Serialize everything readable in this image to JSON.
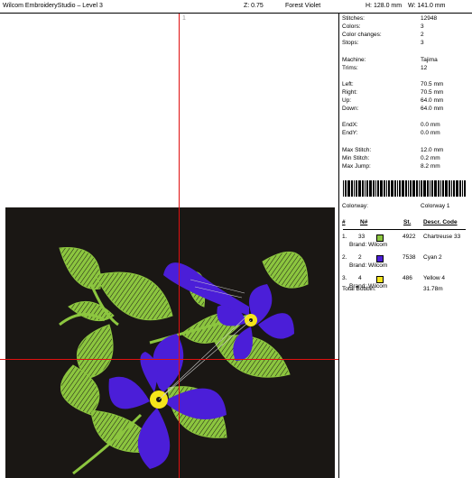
{
  "title_bar": {
    "app_title": "Wilcom EmbroideryStudio – Level 3",
    "zoom": "Z: 0.75",
    "fabric": "Forest Violet",
    "height": "H: 128.0 mm",
    "width": "W: 141.0 mm"
  },
  "canvas": {
    "origin_marker": "1"
  },
  "stats": [
    {
      "label": "Stitches:",
      "value": "12948"
    },
    {
      "label": "Colors:",
      "value": "3"
    },
    {
      "label": "Color changes:",
      "value": "2"
    },
    {
      "label": "Stops:",
      "value": "3"
    },
    {
      "label": "Machine:",
      "value": "Tajima"
    },
    {
      "label": "Trims:",
      "value": "12"
    },
    {
      "label": "Left:",
      "value": "70.5 mm"
    },
    {
      "label": "Right:",
      "value": "70.5 mm"
    },
    {
      "label": "Up:",
      "value": "64.0 mm"
    },
    {
      "label": "Down:",
      "value": "64.0 mm"
    },
    {
      "label": "EndX:",
      "value": "0.0 mm"
    },
    {
      "label": "EndY:",
      "value": "0.0 mm"
    },
    {
      "label": "Max Stitch:",
      "value": "12.0 mm"
    },
    {
      "label": "Min Stitch:",
      "value": "0.2 mm"
    },
    {
      "label": "Max Jump:",
      "value": "8.2 mm"
    }
  ],
  "colorway": {
    "label": "Colorway:",
    "value": "Colorway 1"
  },
  "table": {
    "headers": {
      "index": "#",
      "n": "N#",
      "st": "St.",
      "desc": "Descr. Code"
    },
    "rows": [
      {
        "index": "1.",
        "n": "33",
        "color": "#8cc63f",
        "st": "4922",
        "desc": "Chartreuse 33",
        "brand": "Brand: Wilcom"
      },
      {
        "index": "2.",
        "n": "2",
        "color": "#4b1ed8",
        "st": "7538",
        "desc": "Cyan 2",
        "brand": "Brand: Wilcom"
      },
      {
        "index": "3.",
        "n": "4",
        "color": "#f5e51a",
        "st": "486",
        "desc": "Yellow 4",
        "brand": "Brand: Wilcom"
      }
    ],
    "total_bobbin_label": "Total Bobbin:",
    "total_bobbin_value": "31.78m"
  },
  "colors": {
    "background": "#1a1714",
    "crosshair": "#e01010",
    "leaf": "#8cc63f",
    "petal": "#4b1ed8",
    "center": "#f5e51a"
  }
}
